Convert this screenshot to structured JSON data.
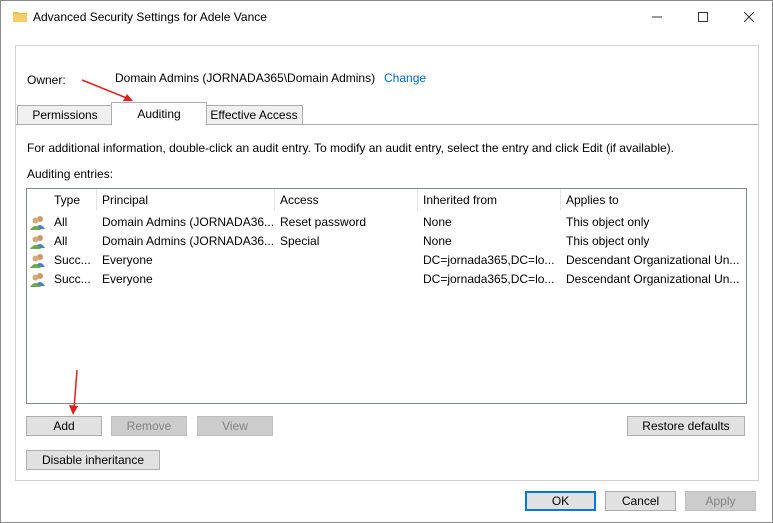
{
  "window": {
    "title": "Advanced Security Settings for Adele Vance",
    "minimize_glyph": "—",
    "maximize_glyph": "☐",
    "close_glyph": "✕"
  },
  "owner": {
    "label": "Owner:",
    "value": "Domain Admins (JORNADA365\\Domain Admins)",
    "change_link": "Change"
  },
  "tabs": [
    {
      "label": "Permissions",
      "active": false
    },
    {
      "label": "Auditing",
      "active": true
    },
    {
      "label": "Effective Access",
      "active": false
    }
  ],
  "info_text": "For additional information, double-click an audit entry. To modify an audit entry, select the entry and click Edit (if available).",
  "entries_label": "Auditing entries:",
  "table": {
    "columns": [
      "Type",
      "Principal",
      "Access",
      "Inherited from",
      "Applies to"
    ],
    "rows": [
      {
        "type": "All",
        "principal": "Domain Admins (JORNADA36...",
        "access": "Reset password",
        "inherited": "None",
        "applies": "This object only"
      },
      {
        "type": "All",
        "principal": "Domain Admins (JORNADA36...",
        "access": "Special",
        "inherited": "None",
        "applies": "This object only"
      },
      {
        "type": "Succ...",
        "principal": "Everyone",
        "access": "",
        "inherited": "DC=jornada365,DC=lo...",
        "applies": "Descendant Organizational Un..."
      },
      {
        "type": "Succ...",
        "principal": "Everyone",
        "access": "",
        "inherited": "DC=jornada365,DC=lo...",
        "applies": "Descendant Organizational Un..."
      }
    ]
  },
  "buttons": {
    "add": "Add",
    "remove": "Remove",
    "view": "View",
    "restore_defaults": "Restore defaults",
    "disable_inheritance": "Disable inheritance",
    "ok": "OK",
    "cancel": "Cancel",
    "apply": "Apply"
  },
  "colors": {
    "link": "#0066cc",
    "accent_border": "#0078d7",
    "annotation_arrow": "#e02020"
  },
  "icons": {
    "title": "folder-icon",
    "row": "users-icon"
  }
}
